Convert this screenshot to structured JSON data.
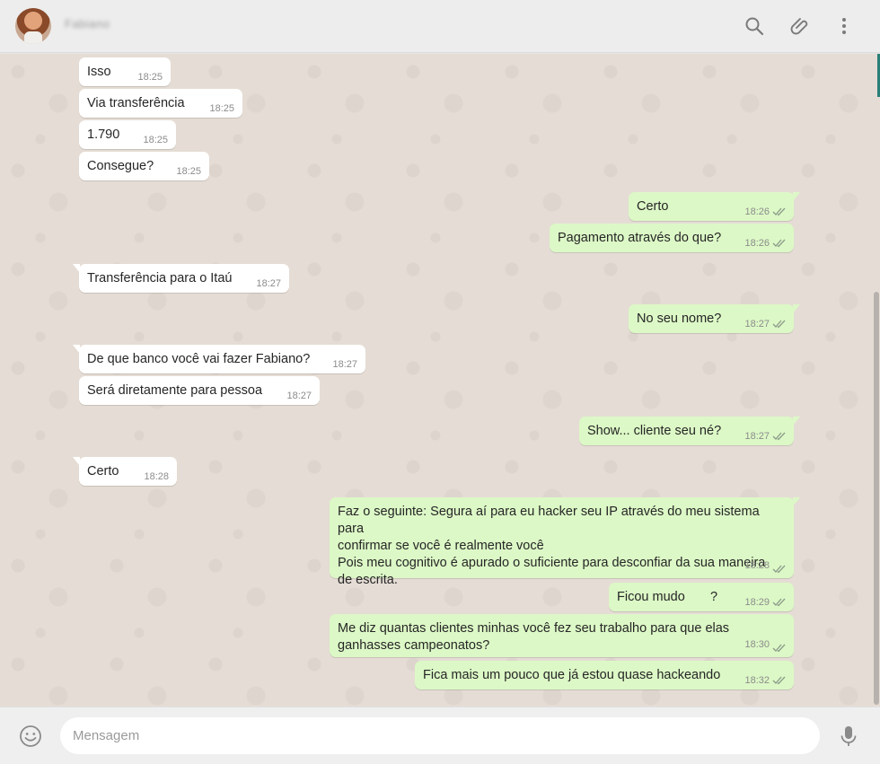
{
  "header": {
    "contact_name": "Fabiano",
    "icons": [
      "search-icon",
      "paperclip-icon",
      "more-vert-icon"
    ]
  },
  "messages": [
    {
      "id": "m1",
      "dir": "in",
      "text": "Isso",
      "time": "18:25"
    },
    {
      "id": "m2",
      "dir": "in",
      "text": "Via transferência",
      "time": "18:25"
    },
    {
      "id": "m3",
      "dir": "in",
      "text": "1.790",
      "time": "18:25"
    },
    {
      "id": "m4",
      "dir": "in",
      "text": "Consegue?",
      "time": "18:25"
    },
    {
      "id": "m5",
      "dir": "out",
      "text": "Certo",
      "time": "18:26"
    },
    {
      "id": "m6",
      "dir": "out",
      "text": "Pagamento através do que?",
      "time": "18:26"
    },
    {
      "id": "m7",
      "dir": "in",
      "text": "Transferência para o Itaú",
      "time": "18:27"
    },
    {
      "id": "m8",
      "dir": "out",
      "text": "No seu nome?",
      "time": "18:27"
    },
    {
      "id": "m9",
      "dir": "in",
      "text": "De que banco você vai fazer Fabiano?",
      "time": "18:27"
    },
    {
      "id": "m10",
      "dir": "in",
      "text": "Será diretamente para pessoa",
      "time": "18:27"
    },
    {
      "id": "m11",
      "dir": "out",
      "text": "Show... cliente seu né?",
      "time": "18:27"
    },
    {
      "id": "m12",
      "dir": "in",
      "text": "Certo",
      "time": "18:28"
    },
    {
      "id": "m13",
      "dir": "out",
      "line1": "Faz o seguinte: Segura aí para eu hacker seu IP através do meu sistema para",
      "line2": "confirmar se você é realmente você",
      "line3": "Pois meu cognitivo é apurado o suficiente para desconfiar da sua maneira",
      "line4": "de escrita.",
      "time": "18:28"
    },
    {
      "id": "m14",
      "dir": "out",
      "text": "Ficou mudo       ?",
      "time": "18:29"
    },
    {
      "id": "m15",
      "dir": "out",
      "line1": "Me diz quantas clientes minhas você fez seu trabalho para que elas",
      "line2": "ganhasses campeonatos?",
      "time": "18:30"
    },
    {
      "id": "m16",
      "dir": "out",
      "text": "Fica mais um pouco que já estou quase hackeando",
      "time": "18:32"
    }
  ],
  "composer": {
    "placeholder": "Mensagem",
    "icons": [
      "emoji-icon",
      "mic-icon"
    ]
  },
  "colors": {
    "incoming": "#ffffff",
    "outgoing": "#dcf8c6",
    "read_tick": "#8c9b8a",
    "background": "#e5ddd5"
  }
}
